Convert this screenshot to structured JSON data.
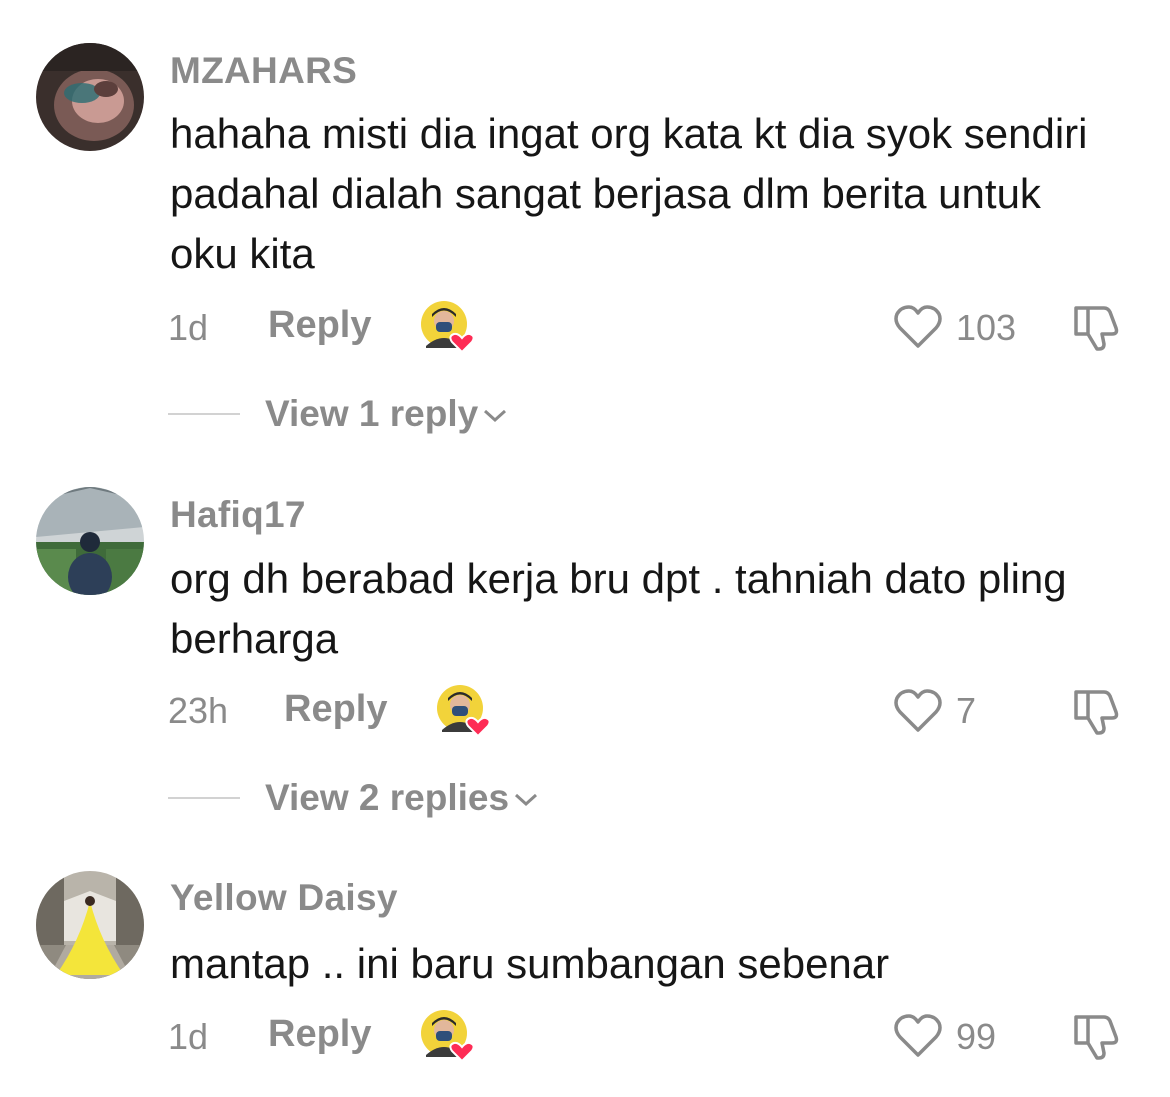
{
  "comments": [
    {
      "username": "MZAHARS",
      "text": "hahaha misti dia ingat org kata kt dia syok sendiri padahal dialah sangat berjasa dlm berita untuk oku kita",
      "time": "1d",
      "reply_label": "Reply",
      "likes": "103",
      "view_replies": "View 1 reply"
    },
    {
      "username": "Hafiq17",
      "text": "org dh berabad kerja bru dpt . tahniah dato pling berharga",
      "time": "23h",
      "reply_label": "Reply",
      "likes": "7",
      "view_replies": "View 2 replies"
    },
    {
      "username": "Yellow Daisy",
      "text": "mantap .. ini baru sumbangan sebenar",
      "time": "1d",
      "reply_label": "Reply",
      "likes": "99"
    }
  ],
  "colors": {
    "secondary_text": "#8a8a8a",
    "primary_text": "#161616",
    "heart_badge": "#fe2c55"
  },
  "icons": [
    "heart-outline-icon",
    "thumbs-down-icon",
    "chevron-down-icon",
    "creator-liked-heart-icon"
  ]
}
